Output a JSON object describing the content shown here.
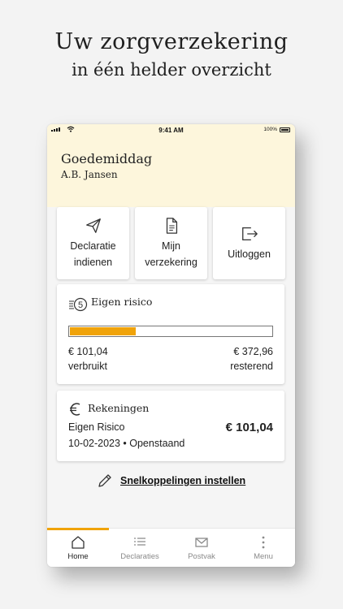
{
  "promo": {
    "title": "Uw zorgverzekering",
    "subtitle": "in één helder overzicht"
  },
  "status_bar": {
    "time": "9:41 AM",
    "battery": "100%"
  },
  "header": {
    "greeting": "Goedemiddag",
    "user_name": "A.B. Jansen"
  },
  "tiles": [
    {
      "icon": "send-icon",
      "line1": "Declaratie",
      "line2": "indienen"
    },
    {
      "icon": "document-icon",
      "line1": "Mijn",
      "line2": "verzekering"
    },
    {
      "icon": "logout-icon",
      "line1": "Uitloggen",
      "line2": ""
    }
  ],
  "eigen_risico": {
    "icon": "coins-5-icon",
    "title": "Eigen risico",
    "used_amount": "€ 101,04",
    "used_label": "verbruikt",
    "remaining_amount": "€ 372,96",
    "remaining_label": "resterend",
    "progress_fraction": 0.33,
    "accent_color": "#f0a30a"
  },
  "rekeningen": {
    "icon": "euro-icon",
    "title": "Rekeningen",
    "item_name": "Eigen Risico",
    "item_amount": "€ 101,04",
    "item_meta": "10-02-2023 • Openstaand"
  },
  "shortcuts": {
    "icon": "pencil-icon",
    "label": "Snelkoppelingen instellen"
  },
  "tabbar": {
    "tabs": [
      {
        "icon": "home-icon",
        "label": "Home",
        "active": true
      },
      {
        "icon": "list-icon",
        "label": "Declaraties",
        "active": false
      },
      {
        "icon": "mail-icon",
        "label": "Postvak",
        "active": false
      },
      {
        "icon": "more-vertical-icon",
        "label": "Menu",
        "active": false
      }
    ]
  },
  "colors": {
    "header_bg": "#fdf6dc",
    "accent": "#f0a30a",
    "page_bg": "#f3f3f3"
  }
}
